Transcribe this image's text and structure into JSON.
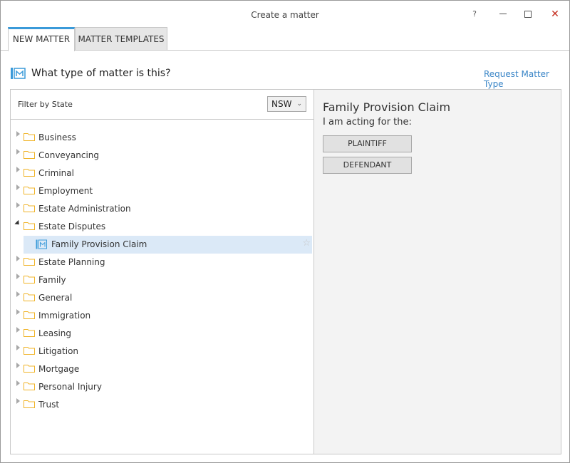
{
  "window": {
    "title": "Create a matter",
    "help": "?",
    "close": "✕"
  },
  "tabs": [
    {
      "label": "NEW MATTER",
      "active": true
    },
    {
      "label": "MATTER TEMPLATES",
      "active": false
    }
  ],
  "header": {
    "question": "What type of matter is this?",
    "request_link": "Request Matter Type"
  },
  "filter": {
    "label": "Filter by State",
    "state": "NSW"
  },
  "tree": {
    "items": [
      "Business",
      "Conveyancing",
      "Criminal",
      "Employment",
      "Estate Administration",
      "Estate Disputes",
      "Estate Planning",
      "Family",
      "General",
      "Immigration",
      "Leasing",
      "Litigation",
      "Mortgage",
      "Personal Injury",
      "Trust"
    ],
    "expanded": "Estate Disputes",
    "child": "Family Provision Claim"
  },
  "detail": {
    "title": "Family Provision Claim",
    "subtitle": "I am acting for the:",
    "roles": [
      "PLAINTIFF",
      "DEFENDANT"
    ]
  },
  "colors": {
    "accent": "#3a9ad9",
    "link": "#3b86c7",
    "folder": "#f0b429",
    "selected_row": "#dbe9f7",
    "close": "#c42b1c"
  }
}
